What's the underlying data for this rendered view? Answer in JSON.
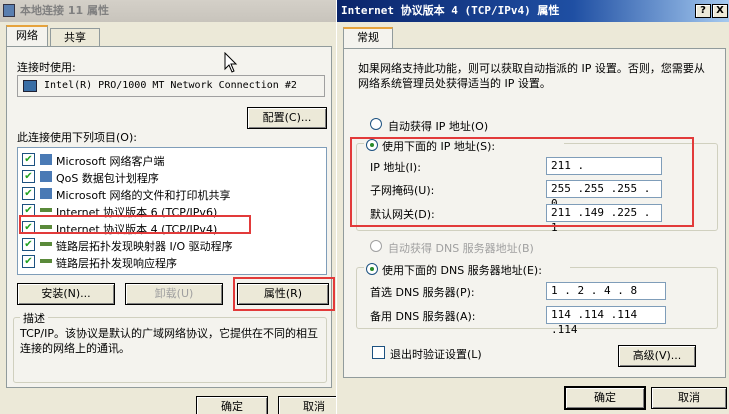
{
  "left_window": {
    "title": "本地连接 11 属性",
    "tabs": [
      "网络",
      "共享"
    ],
    "connect_using_label": "连接时使用:",
    "adapter_name": "Intel(R) PRO/1000 MT Network Connection #2",
    "configure_button": "配置(C)...",
    "items_label": "此连接使用下列项目(O):",
    "items": [
      {
        "label": "Microsoft 网络客户端",
        "checked": true,
        "icon": "network-client-icon"
      },
      {
        "label": "QoS 数据包计划程序",
        "checked": true,
        "icon": "qos-icon"
      },
      {
        "label": "Microsoft 网络的文件和打印机共享",
        "checked": true,
        "icon": "file-share-icon"
      },
      {
        "label": "Internet 协议版本 6 (TCP/IPv6)",
        "checked": true,
        "icon": "protocol-icon"
      },
      {
        "label": "Internet 协议版本 4 (TCP/IPv4)",
        "checked": true,
        "icon": "protocol-icon"
      },
      {
        "label": "链路层拓扑发现映射器 I/O 驱动程序",
        "checked": true,
        "icon": "protocol-icon"
      },
      {
        "label": "链路层拓扑发现响应程序",
        "checked": true,
        "icon": "protocol-icon"
      }
    ],
    "install_button": "安装(N)...",
    "uninstall_button": "卸载(U)",
    "properties_button": "属性(R)",
    "description_label": "描述",
    "description_text": "TCP/IP。该协议是默认的广域网络协议，它提供在不同的相互连接的网络上的通讯。",
    "ok_button": "确定",
    "cancel_button": "取消"
  },
  "right_window": {
    "title": "Internet 协议版本 4 (TCP/IPv4) 属性",
    "help_button": "?",
    "close_button": "X",
    "tab": "常规",
    "intro_text": "如果网络支持此功能，则可以获取自动指派的 IP 设置。否则，您需要从网络系统管理员处获得适当的 IP 设置。",
    "auto_ip_label": "自动获得 IP 地址(O)",
    "manual_ip_label": "使用下面的 IP 地址(S):",
    "ip_address_label": "IP 地址(I):",
    "ip_address_value": "211 .",
    "subnet_label": "子网掩码(U):",
    "subnet_value": "255 .255 .255 . 0",
    "gateway_label": "默认网关(D):",
    "gateway_value": "211 .149 .225 . 1",
    "auto_dns_label": "自动获得 DNS 服务器地址(B)",
    "manual_dns_label": "使用下面的 DNS 服务器地址(E):",
    "preferred_dns_label": "首选 DNS 服务器(P):",
    "preferred_dns_value": "1  . 2  . 4  . 8",
    "alternate_dns_label": "备用 DNS 服务器(A):",
    "alternate_dns_value": "114 .114 .114 .114",
    "validate_label": "退出时验证设置(L)",
    "advanced_button": "高级(V)...",
    "ok_button": "确定",
    "cancel_button": "取消"
  },
  "colors": {
    "highlight": "#e23a3a",
    "active_title": "#0a246a",
    "window_bg": "#ece9d8"
  }
}
